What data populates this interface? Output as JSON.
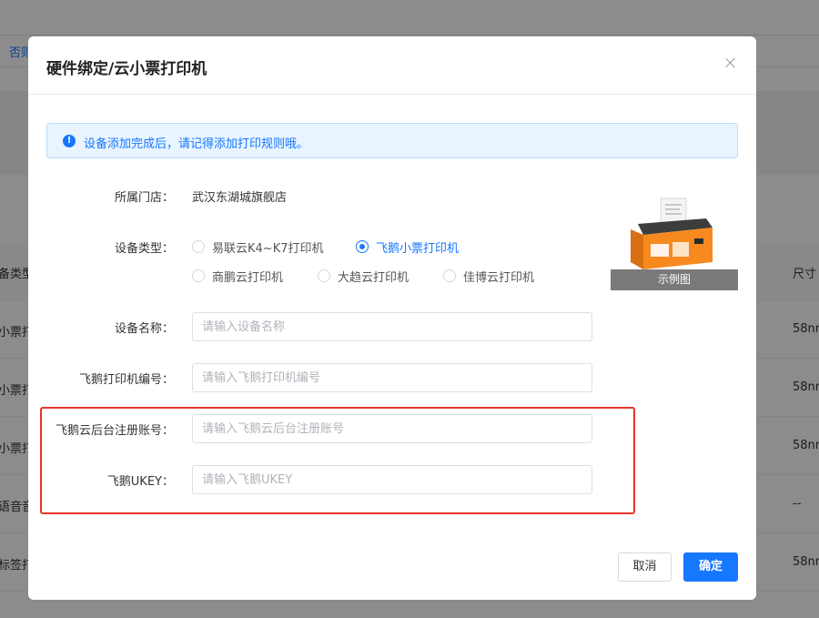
{
  "background": {
    "link_text": "否则",
    "table_header_left": "备类型",
    "table_header_right": "尺寸",
    "rows": [
      {
        "left": "小票打",
        "right": "58nn"
      },
      {
        "left": "小票打",
        "right": "58nn"
      },
      {
        "left": "小票打",
        "right": "58nn"
      },
      {
        "left": "语音音",
        "right": "--"
      },
      {
        "left": "标签打",
        "right": "58nn"
      }
    ]
  },
  "dialog": {
    "title": "硬件绑定/云小票打印机",
    "close_icon": "close-icon",
    "alert_icon": "info-icon",
    "alert_text": "设备添加完成后，请记得添加打印规则哦。",
    "store": {
      "label": "所属门店：",
      "value": "武汉东湖城旗舰店"
    },
    "device_type": {
      "label": "设备类型：",
      "options": [
        {
          "label": "易联云K4~K7打印机",
          "selected": false
        },
        {
          "label": "飞鹅小票打印机",
          "selected": true
        },
        {
          "label": "商鹏云打印机",
          "selected": false
        },
        {
          "label": "大趋云打印机",
          "selected": false
        },
        {
          "label": "佳博云打印机",
          "selected": false
        }
      ]
    },
    "fields": {
      "device_name": {
        "label": "设备名称：",
        "placeholder": "请输入设备名称",
        "value": ""
      },
      "printer_sn": {
        "label": "飞鹅打印机编号：",
        "placeholder": "请输入飞鹅打印机编号",
        "value": ""
      },
      "account": {
        "label": "飞鹅云后台注册账号：",
        "placeholder": "请输入飞鹅云后台注册账号",
        "value": ""
      },
      "ukey": {
        "label": "飞鹅UKEY：",
        "placeholder": "请输入飞鹅UKEY",
        "value": ""
      }
    },
    "example_caption": "示例图",
    "buttons": {
      "cancel": "取消",
      "ok": "确定"
    },
    "colors": {
      "primary": "#1677ff",
      "highlight": "#e8342b",
      "printer_orange": "#f7891f"
    }
  }
}
